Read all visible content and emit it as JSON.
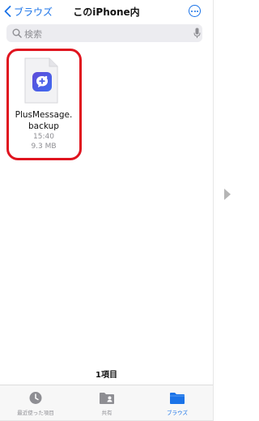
{
  "nav": {
    "back_label": "ブラウズ",
    "title": "このiPhone内",
    "more_icon": "ellipsis-circle-icon"
  },
  "search": {
    "placeholder": "検索",
    "icon": "search-icon",
    "mic_icon": "microphone-icon"
  },
  "file": {
    "name_line1": "PlusMessage.",
    "name_line2": "backup",
    "time": "15:40",
    "size": "9.3 MB",
    "icon": "plusmessage-app-icon",
    "highlight_color": "#e0141f"
  },
  "footer": {
    "item_count": "1項目"
  },
  "tabs": [
    {
      "label": "最近使った項目",
      "icon": "clock-icon",
      "active": false
    },
    {
      "label": "共有",
      "icon": "shared-folder-icon",
      "active": false
    },
    {
      "label": "ブラウズ",
      "icon": "folder-icon",
      "active": true
    }
  ],
  "colors": {
    "accent": "#1a73e8",
    "text": "#111111",
    "secondary": "#8e8e93"
  },
  "next_arrow_icon": "triangle-right-icon"
}
